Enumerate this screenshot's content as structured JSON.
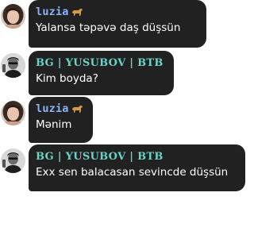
{
  "colors": {
    "bubble_bg": "#212121",
    "text": "#ffffff",
    "name_luzia": "#8ab4f8",
    "name_bg": "#6ad3c8"
  },
  "messages": [
    {
      "sender": "luzia",
      "emoji": "dog-emoji",
      "text": "Yalansa təpəvə daş düşsün"
    },
    {
      "sender": "BG | YUSUBOV | BTB",
      "text": "Kim boyda?"
    },
    {
      "sender": "luzia",
      "emoji": "dog-emoji",
      "text": "Mənim"
    },
    {
      "sender": "BG | YUSUBOV | BTB",
      "text": "Exx sen balacasan sevincde düşsün"
    }
  ]
}
